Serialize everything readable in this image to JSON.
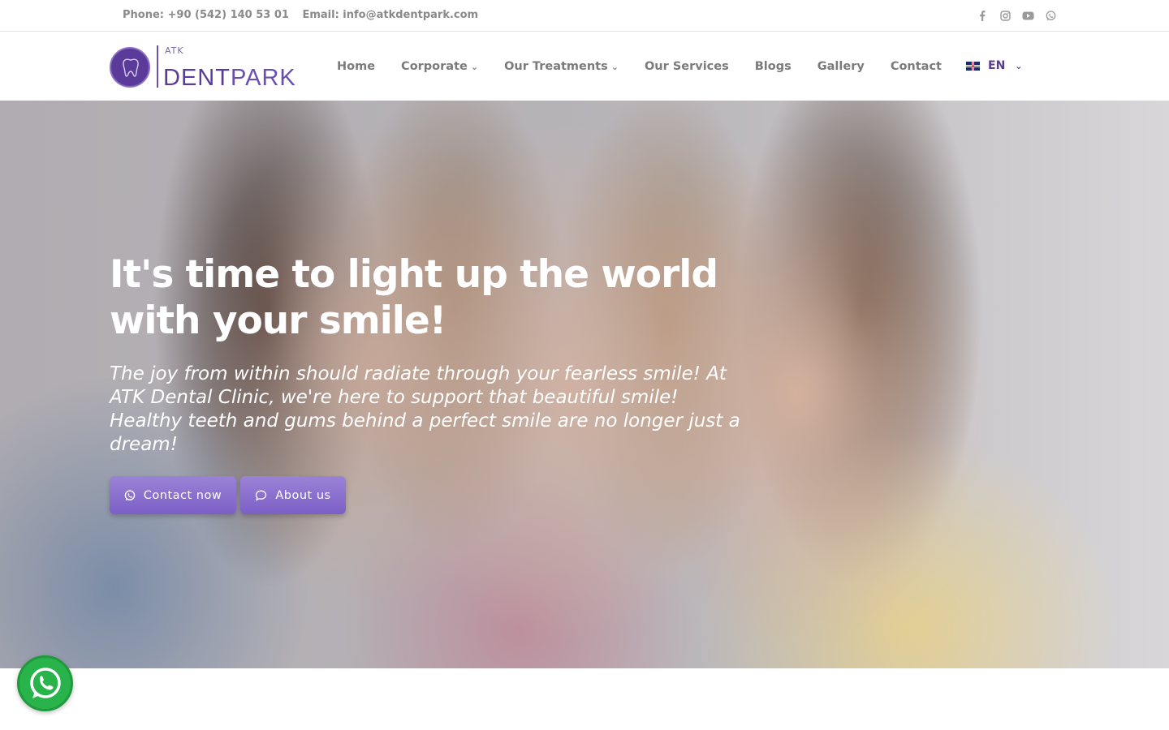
{
  "topbar": {
    "phone": "Phone: +90 (542) 140 53 01",
    "email": "Email: info@atkdentpark.com",
    "social": [
      {
        "icon": "facebook-icon"
      },
      {
        "icon": "instagram-icon"
      },
      {
        "icon": "youtube-icon"
      },
      {
        "icon": "whatsapp-icon"
      }
    ]
  },
  "logo": {
    "small": "ATK",
    "dent": "DENT",
    "park": "PARK"
  },
  "nav": {
    "items": [
      {
        "label": "Home",
        "dropdown": false
      },
      {
        "label": "Corporate",
        "dropdown": true
      },
      {
        "label": "Our Treatments",
        "dropdown": true
      },
      {
        "label": "Our Services",
        "dropdown": false
      },
      {
        "label": "Blogs",
        "dropdown": false
      },
      {
        "label": "Gallery",
        "dropdown": false
      },
      {
        "label": "Contact",
        "dropdown": false
      }
    ],
    "language": "EN"
  },
  "hero": {
    "title_line1": "It's time to light up the world",
    "title_line2": "with your smile!",
    "lead": "The joy from within should radiate through your fearless smile! At ATK Dental Clinic, we're here to support that beautiful smile! Healthy teeth and gums behind a perfect smile are no longer just a dream!",
    "contact_button": "Contact now",
    "about_button": "About us"
  },
  "colors": {
    "brand_purple": "#5b3b9a",
    "button_purple": "#8a6fce",
    "whatsapp_green": "#29b34b",
    "nav_text": "#7b7b7b"
  }
}
